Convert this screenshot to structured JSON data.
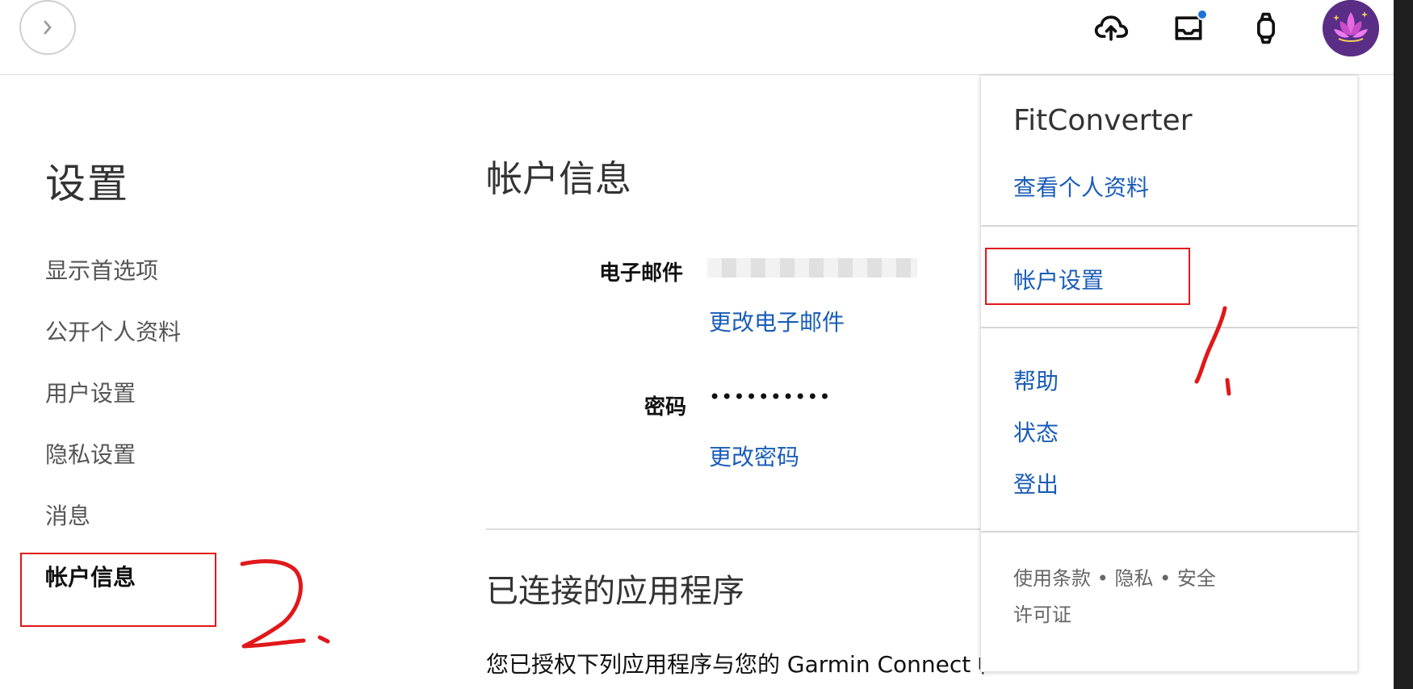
{
  "header": {
    "nav_toggle_icon": "chevron-right-icon",
    "icons": {
      "upload": "cloud-upload-icon",
      "inbox": "inbox-icon",
      "watch": "watch-icon",
      "avatar": "lotus-icon"
    }
  },
  "sidebar": {
    "title": "设置",
    "items": [
      {
        "label": "显示首选项"
      },
      {
        "label": "公开个人资料"
      },
      {
        "label": "用户设置"
      },
      {
        "label": "隐私设置"
      },
      {
        "label": "消息"
      },
      {
        "label": "帐户信息"
      }
    ]
  },
  "main": {
    "section_title": "帐户信息",
    "email_label": "电子邮件",
    "change_email_link": "更改电子邮件",
    "password_label": "密码",
    "password_value": "••••••••••",
    "change_password_link": "更改密码",
    "connected_apps_title": "已连接的应用程序",
    "connected_apps_text": "您已授权下列应用程序与您的 Garmin Connect 帐"
  },
  "dropdown": {
    "user_name": "FitConverter",
    "view_profile": "查看个人资料",
    "account_settings": "帐户设置",
    "help": "帮助",
    "status": "状态",
    "logout": "登出",
    "footer": {
      "terms": "使用条款",
      "privacy": "隐私",
      "security": "安全",
      "separator": "•",
      "license": "许可证"
    }
  },
  "colors": {
    "link": "#1a5db8",
    "annotation": "#e0181b",
    "notification_dot": "#1e73d6"
  }
}
